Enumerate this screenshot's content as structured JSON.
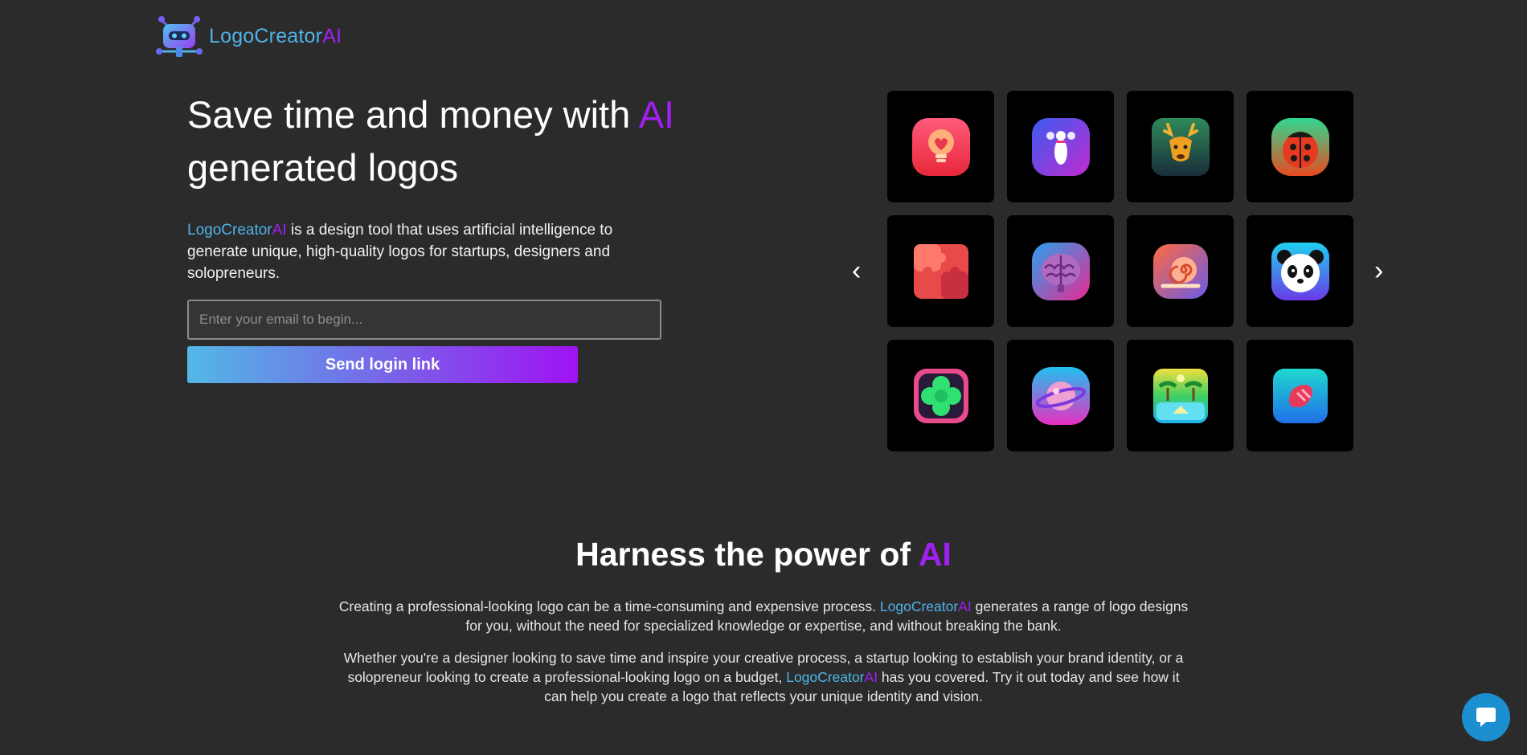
{
  "brand": {
    "name_main": "LogoCreator",
    "name_ai": "AI",
    "icon": "robot-logo-icon"
  },
  "hero": {
    "title_before": "Save time and money with ",
    "title_ai": "AI",
    "title_after": "generated logos",
    "desc_brand_main": "LogoCreator",
    "desc_brand_ai": "AI",
    "desc_text": " is a design tool that uses artificial intelligence to generate unique, high-quality logos for startups, designers and solopreneurs.",
    "email_placeholder": "Enter your email to begin...",
    "email_value": "",
    "send_label": "Send login link"
  },
  "gallery": {
    "prev_label": "‹",
    "next_label": "›",
    "tiles": [
      "lightbulb-heart-icon",
      "bowling-icon",
      "deer-icon",
      "ladybug-icon",
      "puzzle-icon",
      "brain-icon",
      "snail-icon",
      "panda-icon",
      "clover-icon",
      "planet-icon",
      "palm-beach-icon",
      "gem-icon"
    ]
  },
  "section": {
    "title_before": "Harness the power of ",
    "title_ai": "AI",
    "p1_before": "Creating a professional-looking logo can be a time-consuming and expensive process. ",
    "p1_brand_main": "LogoCreator",
    "p1_brand_ai": "AI",
    "p1_after": " generates a range of logo designs for you, without the need for specialized knowledge or expertise, and without breaking the bank.",
    "p2_before": "Whether you're a designer looking to save time and inspire your creative process, a startup looking to establish your brand identity, or a solopreneur looking to create a professional-looking logo on a budget, ",
    "p2_brand_main": "LogoCreator",
    "p2_brand_ai": "AI",
    "p2_after": " has you covered. Try it out today and see how it can help you create a logo that reflects your unique identity and vision."
  },
  "chat": {
    "icon": "chat-bubble-icon"
  },
  "colors": {
    "background": "#2b2b2b",
    "accent_blue": "#4fb3e8",
    "accent_purple": "#a020f0",
    "tile_bg": "#000000",
    "chat_blue": "#1c8fd1"
  }
}
